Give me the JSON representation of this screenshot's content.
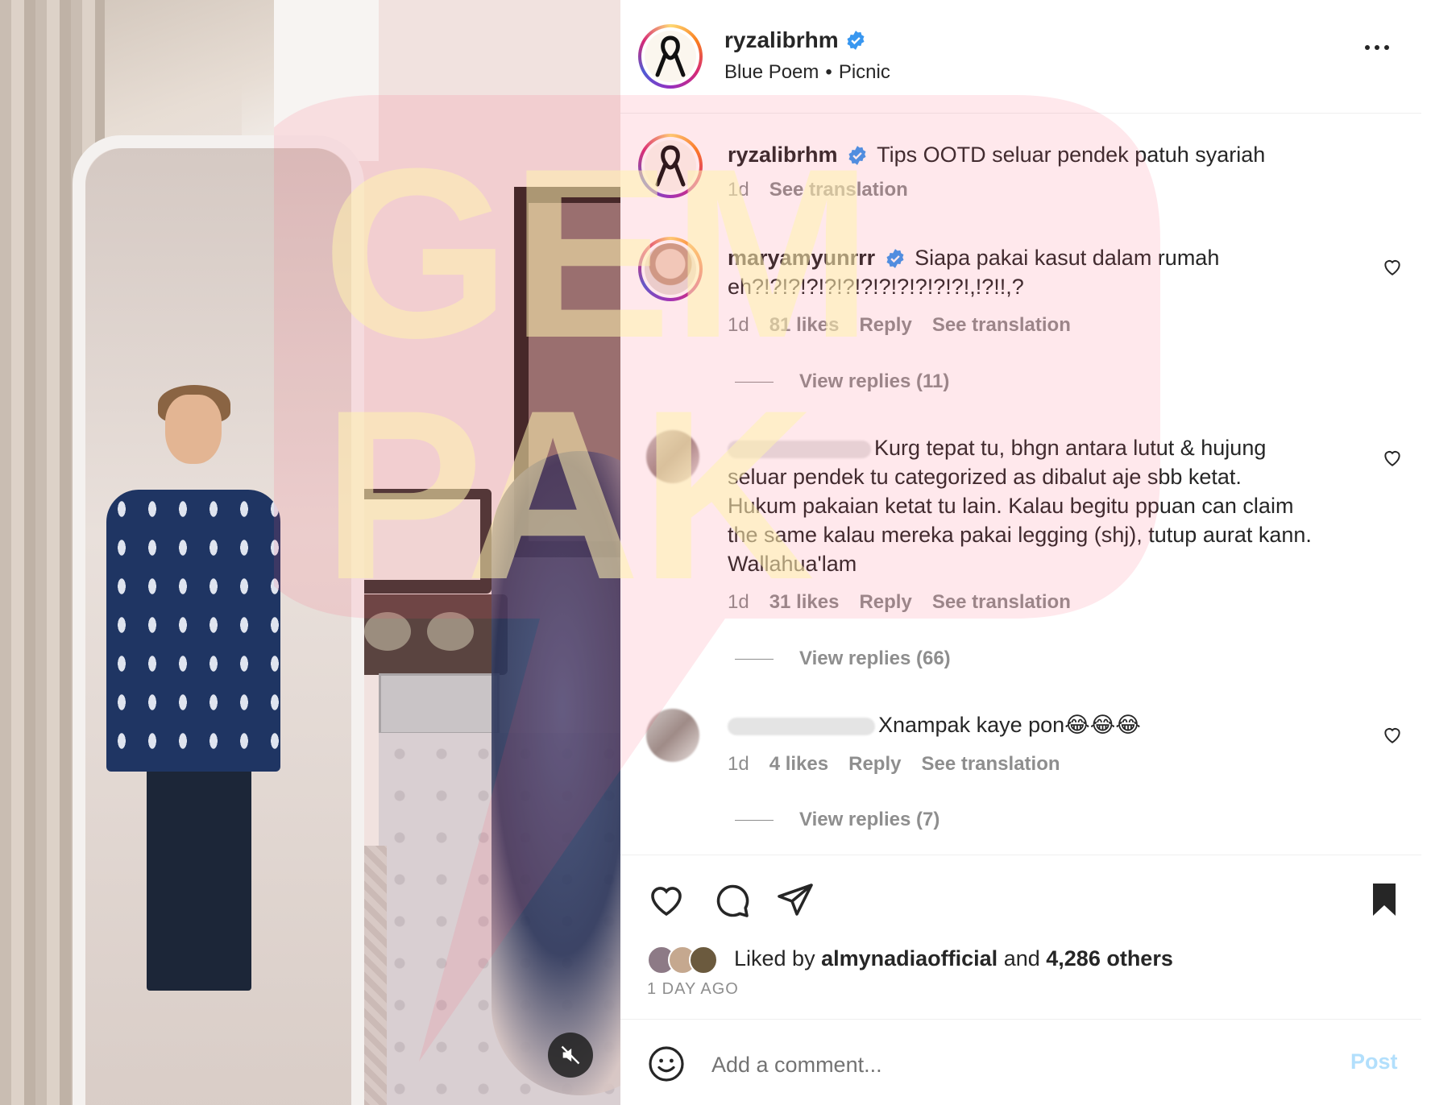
{
  "post": {
    "username": "ryzalibrhm",
    "music_artist": "Blue Poem",
    "music_separator": "•",
    "music_track": "Picnic"
  },
  "caption": {
    "username": "ryzalibrhm",
    "text": "Tips OOTD seluar pendek patuh syariah",
    "time": "1d",
    "see_translation": "See translation"
  },
  "comments": [
    {
      "username": "maryamyunrrr",
      "verified": true,
      "text_line1": "Siapa pakai kasut dalam rumah",
      "text_line2": "eh?!?!?!?!?!?!?!?!?!?!?!?!,!?!!,?",
      "time": "1d",
      "likes": "81 likes",
      "reply": "Reply",
      "see_translation": "See translation",
      "view_replies": "View replies (11)"
    },
    {
      "username_hidden": true,
      "text_line1": "Kurg tepat tu, bhgn antara lutut & hujung",
      "text_line2": "seluar pendek tu categorized as dibalut aje sbb ketat.",
      "text_line3": "Hukum pakaian ketat tu lain. Kalau begitu ppuan can claim",
      "text_line4": "the same kalau mereka pakai legging (shj), tutup aurat kann.",
      "text_line5": "Wallahua'lam",
      "time": "1d",
      "likes": "31 likes",
      "reply": "Reply",
      "see_translation": "See translation",
      "view_replies": "View replies (66)"
    },
    {
      "username_hidden": true,
      "text": "Xnampak kaye pon😂😂😂",
      "time": "1d",
      "likes": "4 likes",
      "reply": "Reply",
      "see_translation": "See translation",
      "view_replies": "View replies (7)"
    }
  ],
  "likes_summary": {
    "prefix": "Liked by",
    "user": "almynadiaofficial",
    "conjunction": "and",
    "others": "4,286 others"
  },
  "time_ago": "1 DAY AGO",
  "add_comment": {
    "placeholder": "Add a comment...",
    "post_label": "Post"
  },
  "watermark": {
    "text_line1": "GEM",
    "text_line2": "PAK"
  },
  "icons": {
    "verified": "verified-badge-icon",
    "more": "more-options-icon",
    "like": "heart-icon",
    "comment": "comment-bubble-icon",
    "share": "paper-plane-icon",
    "save": "bookmark-icon",
    "emoji": "smiley-icon",
    "mute": "muted-speaker-icon"
  },
  "colors": {
    "verified_blue": "#3897f0",
    "post_button_disabled": "#b2dffc",
    "secondary_text": "#8e8e8e",
    "watermark_pink": "#ff4d6d",
    "watermark_yellow": "#fff3b0"
  }
}
